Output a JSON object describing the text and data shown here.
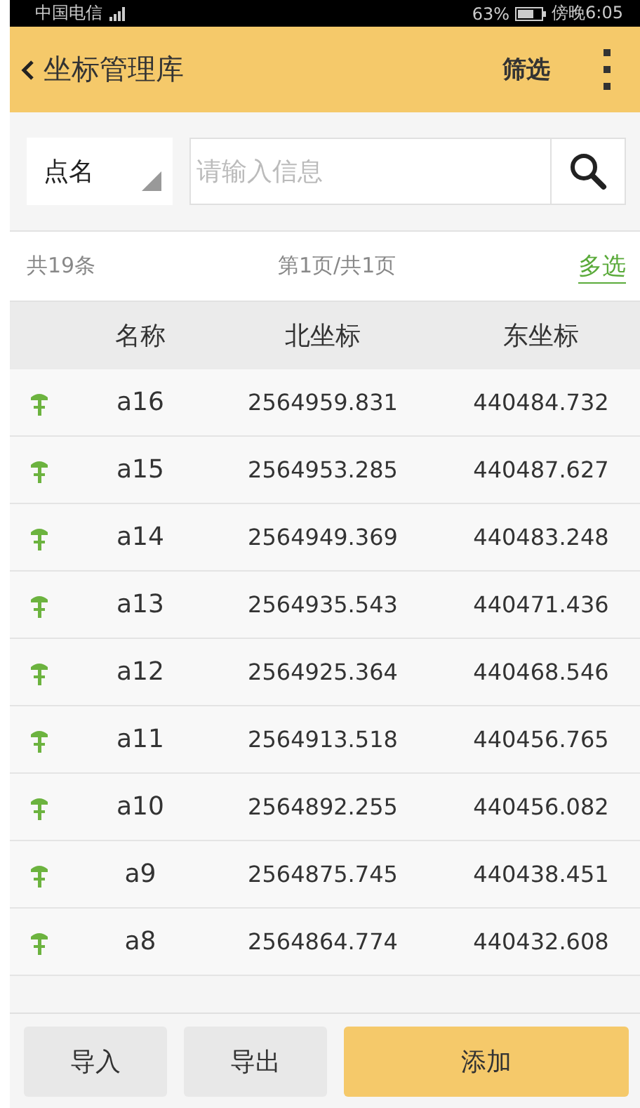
{
  "status_bar": {
    "carrier": "中国电信",
    "battery": "63%",
    "time": "傍晚6:05"
  },
  "header": {
    "title": "坐标管理库",
    "filter": "筛选"
  },
  "search": {
    "field_type": "点名",
    "placeholder": "请输入信息"
  },
  "summary": {
    "total": "共19条",
    "page": "第1页/共1页",
    "multi_select": "多选"
  },
  "table": {
    "columns": [
      "名称",
      "北坐标",
      "东坐标"
    ],
    "rows": [
      {
        "name": "a16",
        "north": "2564959.831",
        "east": "440484.732"
      },
      {
        "name": "a15",
        "north": "2564953.285",
        "east": "440487.627"
      },
      {
        "name": "a14",
        "north": "2564949.369",
        "east": "440483.248"
      },
      {
        "name": "a13",
        "north": "2564935.543",
        "east": "440471.436"
      },
      {
        "name": "a12",
        "north": "2564925.364",
        "east": "440468.546"
      },
      {
        "name": "a11",
        "north": "2564913.518",
        "east": "440456.765"
      },
      {
        "name": "a10",
        "north": "2564892.255",
        "east": "440456.082"
      },
      {
        "name": "a9",
        "north": "2564875.745",
        "east": "440438.451"
      },
      {
        "name": "a8",
        "north": "2564864.774",
        "east": "440432.608"
      }
    ]
  },
  "buttons": [
    {
      "label": "导入",
      "kind": "plain"
    },
    {
      "label": "导出",
      "kind": "plain"
    },
    {
      "label": "添加",
      "kind": "primary"
    }
  ]
}
